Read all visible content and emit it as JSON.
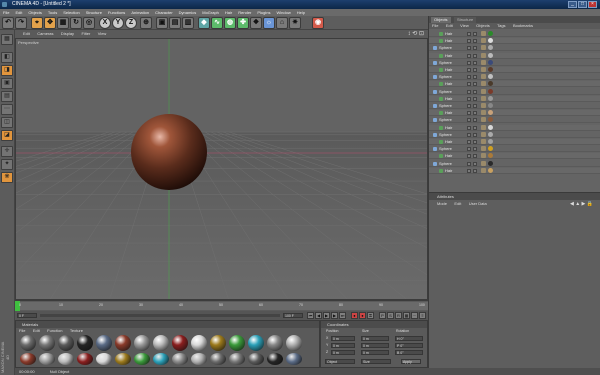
{
  "window": {
    "title": "CINEMA 4D - [Untitled 2 *]",
    "minimize": "_",
    "maximize": "□",
    "close": "×"
  },
  "menubar": [
    "File",
    "Edit",
    "Objects",
    "Tools",
    "Selection",
    "Structure",
    "Functions",
    "Animation",
    "Character",
    "Dynamics",
    "MoGraph",
    "Hair",
    "Render",
    "Plugins",
    "Window",
    "Help"
  ],
  "toolbar": {
    "axis_buttons": [
      "X",
      "Y",
      "Z"
    ]
  },
  "viewport": {
    "menu": [
      "Edit",
      "Cameras",
      "Display",
      "Filter",
      "View"
    ],
    "label": "Perspective"
  },
  "timeline": {
    "ticks": [
      "0",
      "10",
      "20",
      "30",
      "40",
      "50",
      "60",
      "70",
      "80",
      "90",
      "100"
    ],
    "current_frame": "0 F",
    "end_frame": "100 F"
  },
  "materials": {
    "panel_title": "Materials",
    "menu": [
      "File",
      "Edit",
      "Function",
      "Texture"
    ],
    "swatches": [
      {
        "color": "#6b6b6b",
        "row": 0
      },
      {
        "color": "#777777",
        "row": 0
      },
      {
        "color": "#5a5a5a",
        "row": 0
      },
      {
        "color": "#242424",
        "row": 0
      },
      {
        "color": "#5a6b86",
        "row": 0
      },
      {
        "color": "#8a3a2a",
        "row": 0
      },
      {
        "color": "#9a9a9a",
        "row": 0
      },
      {
        "color": "#bbbbbb",
        "row": 0
      },
      {
        "color": "#8a1e1e",
        "row": 0
      },
      {
        "color": "#d8d8d8",
        "row": 0
      },
      {
        "color": "#9c7a1c",
        "row": 0
      },
      {
        "color": "#3a9a3a",
        "row": 0
      },
      {
        "color": "#2aa0b8",
        "row": 0
      },
      {
        "color": "#888888",
        "row": 0
      },
      {
        "color": "#b0b0b0",
        "row": 0
      }
    ]
  },
  "coordinates": {
    "panel_title": "Coordinates",
    "columns": [
      "Position",
      "Size",
      "Rotation"
    ],
    "rows": [
      {
        "axis": "X",
        "pos": "0 m",
        "size": "0 m",
        "rot": "H 0°"
      },
      {
        "axis": "Y",
        "pos": "0 m",
        "size": "0 m",
        "rot": "P 0°"
      },
      {
        "axis": "Z",
        "pos": "0 m",
        "size": "0 m",
        "rot": "B 0°"
      }
    ],
    "mode": "Object",
    "size_mode": "Size",
    "apply": "Apply"
  },
  "status": {
    "time": "00:00:00",
    "message": "Null Object"
  },
  "objects": {
    "tabs": [
      "Objects",
      "Structure"
    ],
    "menu": [
      "File",
      "Edit",
      "View",
      "Objects",
      "Tags",
      "Bookmarks"
    ],
    "rows": [
      {
        "name": "Hair",
        "level": 1,
        "tag_color": "#2a8a2a"
      },
      {
        "name": "Hair",
        "level": 1,
        "tag_color": "#dddddd"
      },
      {
        "name": "Sphere",
        "level": 0,
        "tag_color": "#aaaaaa"
      },
      {
        "name": "Hair",
        "level": 1,
        "tag_color": "#bbbbbb"
      },
      {
        "name": "Sphere",
        "level": 0,
        "tag_color": "#3a4a7a"
      },
      {
        "name": "Hair",
        "level": 1,
        "tag_color": "#5a3a2a"
      },
      {
        "name": "Sphere",
        "level": 0,
        "tag_color": "#c0c0c0"
      },
      {
        "name": "Hair",
        "level": 1,
        "tag_color": "#4a3a2a"
      },
      {
        "name": "Sphere",
        "level": 0,
        "tag_color": "#7a3a2a"
      },
      {
        "name": "Hair",
        "level": 1,
        "tag_color": "#999999"
      },
      {
        "name": "Sphere",
        "level": 0,
        "tag_color": "#888888"
      },
      {
        "name": "Hair",
        "level": 1,
        "tag_color": "#c8a27a"
      },
      {
        "name": "Sphere",
        "level": 0,
        "tag_color": "#8a5a3a"
      },
      {
        "name": "Hair",
        "level": 1,
        "tag_color": "#d8d8d8"
      },
      {
        "name": "Sphere",
        "level": 0,
        "tag_color": "#aaaaaa"
      },
      {
        "name": "Hair",
        "level": 1,
        "tag_color": "#a0a0a0"
      },
      {
        "name": "Sphere",
        "level": 0,
        "tag_color": "#d0a020"
      },
      {
        "name": "Hair",
        "level": 1,
        "tag_color": "#aa7a3a"
      },
      {
        "name": "Sphere",
        "level": 0,
        "tag_color": "#2a2a2a"
      },
      {
        "name": "Hair",
        "level": 1,
        "tag_color": "#c8a060"
      }
    ]
  },
  "attributes": {
    "title": "Attributes",
    "menu": [
      "Mode",
      "Edit",
      "User Data"
    ]
  },
  "logo_text": "MAXON CINEMA 4D",
  "colors": {
    "sphere_base": "#5a2c1c",
    "sphere_highlight": "#d4a090",
    "grid": "#6e6e6e",
    "horizon_line": "#b84a6a",
    "y_axis": "#4aa04a"
  }
}
